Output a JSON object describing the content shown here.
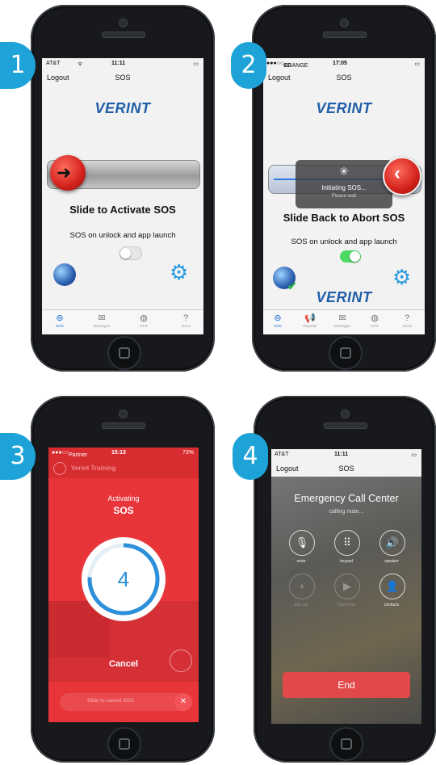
{
  "steps": {
    "s1": "1",
    "s2": "2",
    "s3": "3",
    "s4": "4"
  },
  "p1": {
    "carrier": "AT&T",
    "time": "11:11",
    "logout": "Logout",
    "title": "SOS",
    "logo": "VERINT",
    "slide_label": "Slide to Activate SOS",
    "unlock_label": "SOS on unlock and app launch",
    "unlock_toggle": "off",
    "tabs": [
      {
        "label": "SOS",
        "icon": "sos-icon"
      },
      {
        "label": "Messages",
        "icon": "envelope-icon"
      },
      {
        "label": "GPS",
        "icon": "globe-icon"
      },
      {
        "label": "About",
        "icon": "question-icon"
      }
    ]
  },
  "p2": {
    "carrier": "ORANGE",
    "network": "4G",
    "time": "17:05",
    "logout": "Logout",
    "title": "SOS",
    "logo": "VERINT",
    "initiating": "Initiating SOS...",
    "please_wait": "Please wait",
    "slide_label": "Slide Back to Abort SOS",
    "unlock_label": "SOS on unlock and app launch",
    "unlock_toggle": "on",
    "logo_bottom": "VERINT",
    "tabs": [
      {
        "label": "SOS",
        "icon": "sos-icon"
      },
      {
        "label": "Reporter",
        "icon": "megaphone-icon"
      },
      {
        "label": "Messages",
        "icon": "envelope-icon"
      },
      {
        "label": "GPS",
        "icon": "globe-icon"
      },
      {
        "label": "About",
        "icon": "question-icon"
      }
    ]
  },
  "p3": {
    "carrier": "Partner",
    "time": "15:13",
    "battery": "73%",
    "app_title": "Verint Training",
    "activating": "Activating",
    "sos": "SOS",
    "countdown": "4",
    "cancel": "Cancel",
    "slide_cancel": "Slide to cancel SOS"
  },
  "p4": {
    "carrier": "AT&T",
    "time": "11:11",
    "logout": "Logout",
    "title": "SOS",
    "call_center": "Emergency Call Center",
    "calling": "calling main...",
    "buttons": [
      {
        "label": "mute",
        "icon": "mic-off-icon"
      },
      {
        "label": "keypad",
        "icon": "keypad-icon"
      },
      {
        "label": "speaker",
        "icon": "speaker-icon"
      },
      {
        "label": "add call",
        "icon": "plus-icon"
      },
      {
        "label": "FaceTime",
        "icon": "video-icon"
      },
      {
        "label": "contacts",
        "icon": "contacts-icon"
      }
    ],
    "end": "End"
  },
  "colors": {
    "accent": "#1ea3d8",
    "sos_red": "#e8353a",
    "verint_blue": "#1f5ea8",
    "end_red": "#e0484a",
    "toggle_green": "#4cd964"
  }
}
